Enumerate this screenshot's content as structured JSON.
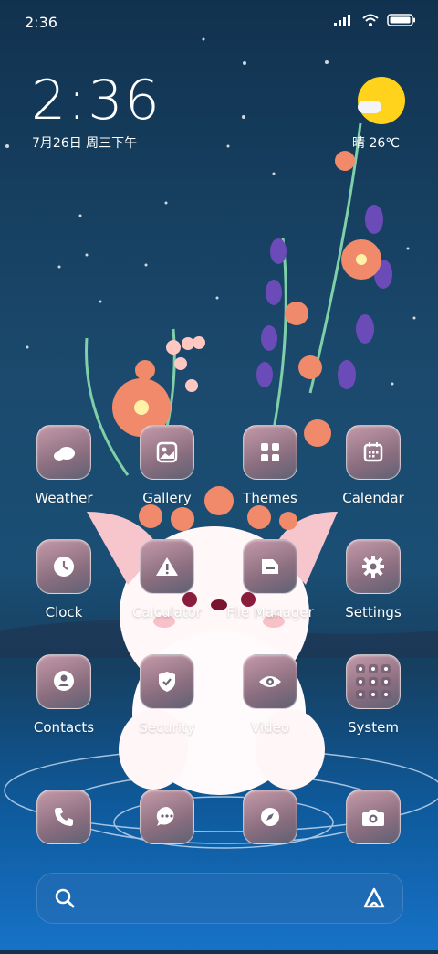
{
  "status_bar": {
    "time": "2:36"
  },
  "lock_widget": {
    "clock": "2:36",
    "date": "7月26日 周三下午",
    "weather": "晴 26℃"
  },
  "apps": [
    {
      "label": "Weather",
      "icon": "cloud-icon"
    },
    {
      "label": "Gallery",
      "icon": "image-icon"
    },
    {
      "label": "Themes",
      "icon": "grid-icon"
    },
    {
      "label": "Calendar",
      "icon": "calendar-icon"
    },
    {
      "label": "Clock",
      "icon": "clock-icon"
    },
    {
      "label": "Calculator",
      "icon": "warning-icon"
    },
    {
      "label": "File Manager",
      "icon": "folder-icon"
    },
    {
      "label": "Settings",
      "icon": "gear-icon"
    },
    {
      "label": "Contacts",
      "icon": "person-icon"
    },
    {
      "label": "Security",
      "icon": "shield-check-icon"
    },
    {
      "label": "Video",
      "icon": "eye-icon"
    },
    {
      "label": "System",
      "icon": "app-folder-icon"
    }
  ],
  "dock": [
    {
      "icon": "phone-icon"
    },
    {
      "icon": "message-icon"
    },
    {
      "icon": "compass-icon"
    },
    {
      "icon": "camera-icon"
    }
  ],
  "search_bar": {
    "left_icon": "search-icon",
    "right_icon": "assistant-icon"
  }
}
